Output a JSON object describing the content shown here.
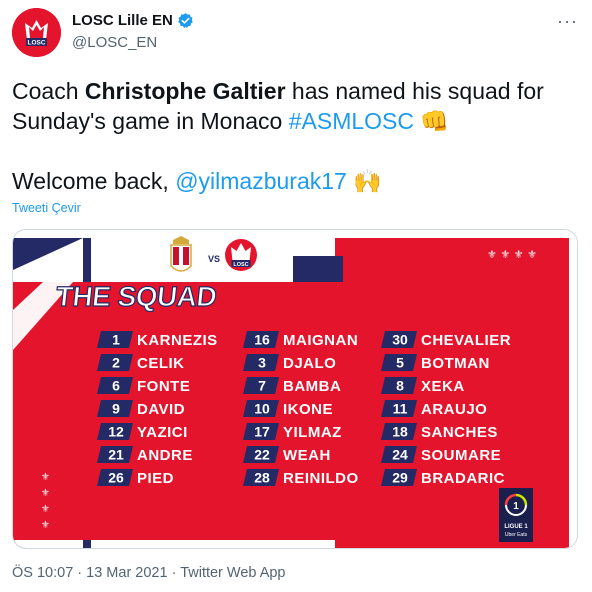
{
  "account": {
    "display_name": "LOSC Lille EN",
    "handle": "@LOSC_EN",
    "avatar_text": "LOSC"
  },
  "tweet": {
    "line1_pre": "Coach ",
    "line1_bold": "Christophe Galtier",
    "line1_post": " has named his squad for",
    "line2_pre": "Sunday's game in Monaco ",
    "hashtag": "#ASMLOSC",
    "emoji1": "👊",
    "line3_pre": "Welcome back, ",
    "mention": "@yilmazburak17",
    "emoji2": "🙌",
    "translate_label": "Tweeti Çevir"
  },
  "graphic": {
    "title": "THE SQUAD",
    "vs": "VS",
    "home_badge_text": "LOSC",
    "league_line1": "LIGUE 1",
    "league_line2": "Uber Eats",
    "league_mark": "1",
    "players": [
      [
        {
          "num": "1",
          "name": "KARNEZIS"
        },
        {
          "num": "2",
          "name": "CELIK"
        },
        {
          "num": "6",
          "name": "FONTE"
        },
        {
          "num": "9",
          "name": "DAVID"
        },
        {
          "num": "12",
          "name": "YAZICI"
        },
        {
          "num": "21",
          "name": "ANDRE"
        },
        {
          "num": "26",
          "name": "PIED"
        }
      ],
      [
        {
          "num": "16",
          "name": "MAIGNAN"
        },
        {
          "num": "3",
          "name": "DJALO"
        },
        {
          "num": "7",
          "name": "BAMBA"
        },
        {
          "num": "10",
          "name": "IKONE"
        },
        {
          "num": "17",
          "name": "YILMAZ"
        },
        {
          "num": "22",
          "name": "WEAH"
        },
        {
          "num": "28",
          "name": "REINILDO"
        }
      ],
      [
        {
          "num": "30",
          "name": "CHEVALIER"
        },
        {
          "num": "5",
          "name": "BOTMAN"
        },
        {
          "num": "8",
          "name": "XEKA"
        },
        {
          "num": "11",
          "name": "ARAUJO"
        },
        {
          "num": "18",
          "name": "SANCHES"
        },
        {
          "num": "24",
          "name": "SOUMARE"
        },
        {
          "num": "29",
          "name": "BRADARIC"
        }
      ]
    ],
    "colors": {
      "red": "#e4142d",
      "navy": "#232a66",
      "white": "#ffffff",
      "monaco_red": "#c8102e",
      "gold": "#d4a93c"
    }
  },
  "footer": {
    "timestamp": "ÖS 10:07 · 13 Mar 2021 · ",
    "source": "Twitter Web App"
  }
}
